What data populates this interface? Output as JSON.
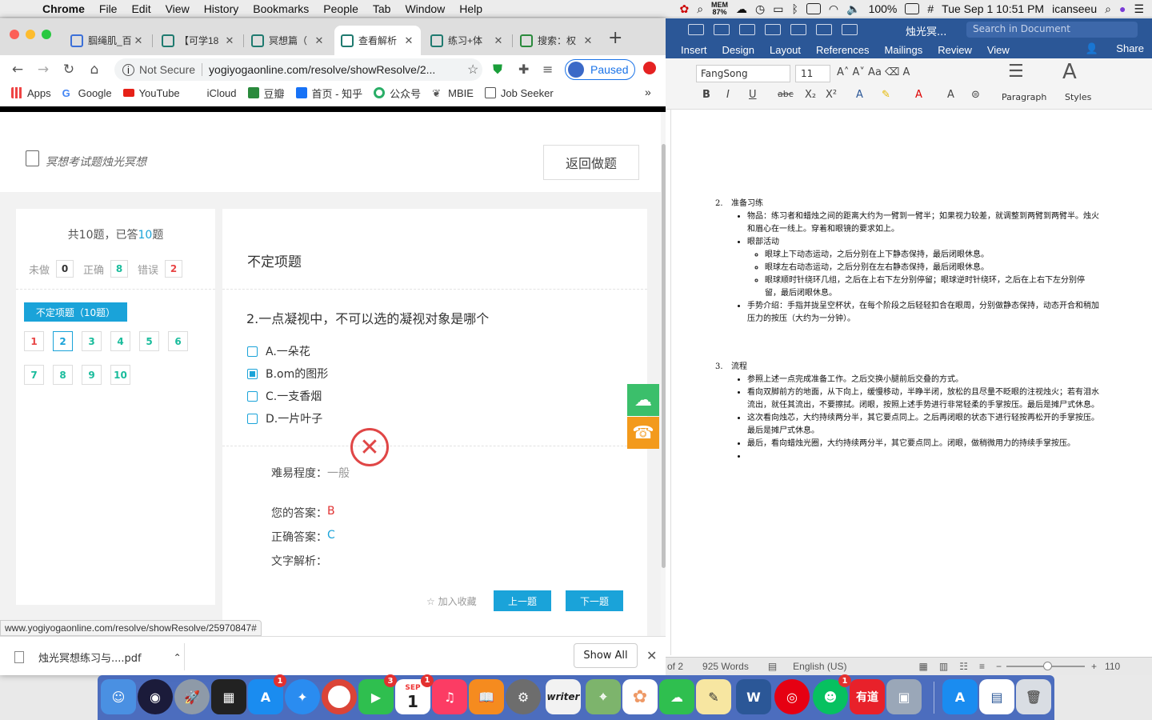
{
  "menubar": {
    "app": "Chrome",
    "items": [
      "File",
      "Edit",
      "View",
      "History",
      "Bookmarks",
      "People",
      "Tab",
      "Window",
      "Help"
    ],
    "mem_label": "MEM",
    "mem_value": "87%",
    "battery": "100%",
    "datetime": "Tue Sep 1  10:51 PM",
    "user": "icanseeu"
  },
  "chrome": {
    "tabs": [
      {
        "title": "腘绳肌_百",
        "active": false
      },
      {
        "title": "【可学18",
        "active": false
      },
      {
        "title": "冥想篇（",
        "active": false
      },
      {
        "title": "查看解析",
        "active": true
      },
      {
        "title": "练习+体",
        "active": false
      },
      {
        "title": "搜索：权",
        "active": false
      }
    ],
    "new_tab": "+",
    "not_secure": "Not Secure",
    "url": "yogiyogaonline.com/resolve/showResolve/2...",
    "paused": "Paused",
    "bookmarks": [
      "Apps",
      "Google",
      "YouTube",
      "iCloud",
      "豆瓣",
      "首页 - 知乎",
      "公众号",
      "MBIE",
      "Job Seeker"
    ],
    "more": "»",
    "hover_url": "www.yogiyogaonline.com/resolve/showResolve/25970847#",
    "download_file": "烛光冥想练习与....pdf",
    "show_all": "Show All"
  },
  "page": {
    "title": "冥想考试题烛光冥想",
    "back_button": "返回做题",
    "summary_prefix": "共10题，已答",
    "summary_count": "10",
    "summary_suffix": "题",
    "stats": {
      "undone_label": "未做",
      "undone": "0",
      "correct_label": "正确",
      "correct": "8",
      "wrong_label": "错误",
      "wrong": "2"
    },
    "section_button": "不定项题（10题）",
    "question_numbers": [
      {
        "n": "1",
        "state": "wrong"
      },
      {
        "n": "2",
        "state": "current"
      },
      {
        "n": "3",
        "state": "correct"
      },
      {
        "n": "4",
        "state": "correct"
      },
      {
        "n": "5",
        "state": "correct"
      },
      {
        "n": "6",
        "state": "correct"
      },
      {
        "n": "7",
        "state": "correct"
      },
      {
        "n": "8",
        "state": "correct"
      },
      {
        "n": "9",
        "state": "correct"
      },
      {
        "n": "10",
        "state": "correct"
      }
    ],
    "question_type": "不定项题",
    "question": "2.一点凝视中，不可以选的凝视对象是哪个",
    "options": [
      {
        "label": "A.一朵花",
        "checked": false
      },
      {
        "label": "B.om的图形",
        "checked": true
      },
      {
        "label": "C.一支香烟",
        "checked": false
      },
      {
        "label": "D.一片叶子",
        "checked": false
      }
    ],
    "difficulty_label": "难易程度：",
    "difficulty": "一般",
    "your_answer_label": "您的答案：",
    "your_answer": "B",
    "correct_answer_label": "正确答案：",
    "correct_answer": "C",
    "explanation_label": "文字解析：",
    "favorite": "☆ 加入收藏",
    "prev": "上一题",
    "next": "下一题",
    "accent": "#1aa3d9",
    "wrong_color": "#e84545",
    "correct_color": "#1abc9c"
  },
  "word": {
    "doc_name": "烛光冥...",
    "search_placeholder": "Search in Document",
    "tabs": [
      "Insert",
      "Design",
      "Layout",
      "References",
      "Mailings",
      "Review",
      "View"
    ],
    "share": "Share",
    "font": "FangSong",
    "size": "11",
    "paragraph_label": "Paragraph",
    "styles_label": "Styles",
    "doc": [
      {
        "num": "2.",
        "title": "准备习练",
        "items": [
          {
            "text": "物品：练习者和蜡烛之间的距离大约为一臂到一臂半；如果视力较差，就调整到两臂到两臂半。烛火和眉心在一线上。穿着和眼镜的要求如上。",
            "sub": []
          },
          {
            "text": "眼部活动",
            "sub": [
              "眼球上下动态运动，之后分别在上下静态保持，最后闭眼休息。",
              "眼球左右动态运动，之后分别在左右静态保持，最后闭眼休息。",
              "眼球顺时针绕环几组，之后在上右下左分别停留；眼球逆时针绕环，之后在上右下左分别停留，最后闭眼休息。"
            ]
          },
          {
            "text": "手势介绍：手指并拢呈空杯状，在每个阶段之后轻轻扣合在眼周，分别做静态保持，动态开合和稍加压力的按压（大约为一分钟）。",
            "sub": []
          }
        ]
      },
      {
        "num": "3.",
        "title": "流程",
        "items": [
          {
            "text": "参照上述一点完成准备工作。之后交换小腿前后交叠的方式。",
            "sub": []
          },
          {
            "text": "看向双脚前方的地面，从下向上，缓慢移动，半睁半闭，放松的且尽量不眨眼的注视烛火；若有泪水流出，就任其流出，不要擦拭。闭眼，按照上述手势进行非常轻柔的手掌按压。最后是摊尸式休息。",
            "sub": []
          },
          {
            "text": "这次看向烛芯，大约持续两分半，其它要点同上。之后再闭眼的状态下进行轻按再松开的手掌按压。最后是摊尸式休息。",
            "sub": []
          },
          {
            "text": "最后，看向蜡烛光圈，大约持续两分半，其它要点同上。闭眼，做稍微用力的持续手掌按压。",
            "sub": []
          },
          {
            "text": "",
            "sub": []
          }
        ]
      }
    ],
    "status_pages": "of 2",
    "status_words": "925 Words",
    "status_lang": "English (US)",
    "zoom": "110"
  },
  "dock": {
    "badges": {
      "appstore": "1",
      "facetime": "3",
      "calendar": "1",
      "wechat": "1"
    },
    "calendar_month": "SEP",
    "calendar_day": "1",
    "writer": "writer",
    "youdao": "有道"
  }
}
